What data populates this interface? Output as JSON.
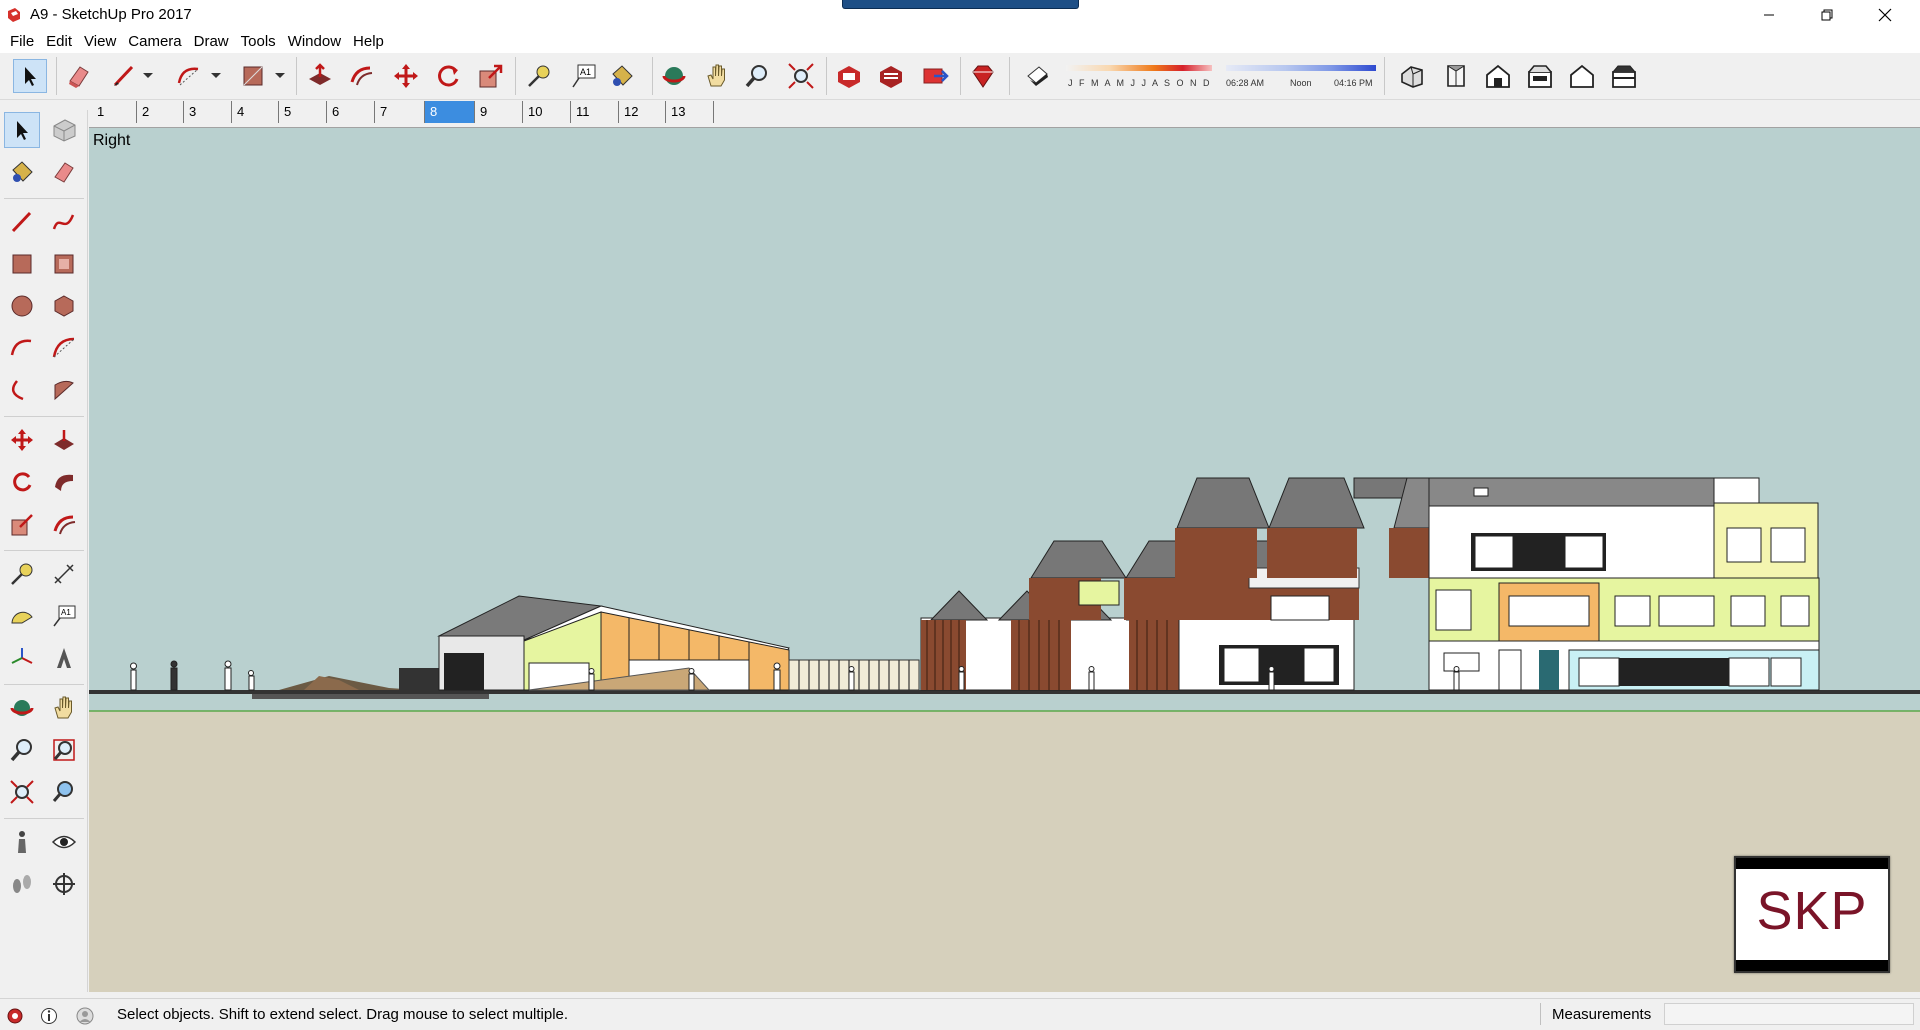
{
  "window": {
    "title": "A9 - SketchUp Pro 2017",
    "controls": [
      "minimize",
      "restore",
      "close"
    ]
  },
  "menu": [
    "File",
    "Edit",
    "View",
    "Camera",
    "Draw",
    "Tools",
    "Window",
    "Help"
  ],
  "toolbar": {
    "tools": [
      {
        "name": "select-icon",
        "active": true
      },
      {
        "name": "eraser-icon"
      },
      {
        "name": "line-icon"
      },
      {
        "name": "arc-icon"
      },
      {
        "name": "rectangle-icon"
      },
      {
        "name": "push-pull-icon"
      },
      {
        "name": "offset-icon"
      },
      {
        "name": "move-icon"
      },
      {
        "name": "rotate-icon"
      },
      {
        "name": "scale-icon"
      },
      {
        "name": "tape-measure-icon"
      },
      {
        "name": "text-icon"
      },
      {
        "name": "paint-bucket-icon"
      },
      {
        "name": "orbit-icon"
      },
      {
        "name": "pan-icon"
      },
      {
        "name": "zoom-icon"
      },
      {
        "name": "zoom-extents-icon"
      },
      {
        "name": "3d-warehouse-icon"
      },
      {
        "name": "extension-warehouse-icon"
      },
      {
        "name": "send-to-layout-icon"
      },
      {
        "name": "extension-manager-icon"
      },
      {
        "name": "shadows-toggle-icon"
      },
      {
        "name": "iso-view-icon"
      },
      {
        "name": "top-view-icon"
      },
      {
        "name": "front-view-icon"
      },
      {
        "name": "right-view-icon"
      },
      {
        "name": "back-view-icon"
      },
      {
        "name": "left-view-icon"
      }
    ],
    "shadow_months": "J F M A M J J A S O N D",
    "shadow_time_start": "06:28 AM",
    "shadow_time_mid": "Noon",
    "shadow_time_end": "04:16 PM"
  },
  "scenes": {
    "tabs": [
      "1",
      "2",
      "3",
      "4",
      "5",
      "6",
      "7",
      "8",
      "9",
      "10",
      "11",
      "12",
      "13"
    ],
    "active": "8"
  },
  "viewport": {
    "view_label": "Right",
    "sky_color": "#b9d0cf",
    "ground_color": "#d6d0bc"
  },
  "watermark": {
    "text": "SKP",
    "color": "#7a1428"
  },
  "statusbar": {
    "message": "Select objects. Shift to extend select. Drag mouse to select multiple.",
    "measurements_label": "Measurements",
    "measurements_value": ""
  }
}
